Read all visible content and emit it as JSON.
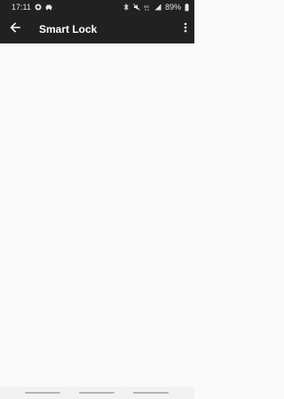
{
  "status_bar": {
    "time": "17:11",
    "battery": "89%",
    "left_icons": [
      "whatsapp-icon",
      "car-icon"
    ],
    "right_icons": [
      "bluetooth-icon",
      "mute-icon",
      "4g-icon",
      "signal-icon",
      "battery-icon"
    ]
  },
  "app_bar": {
    "title": "Smart Lock",
    "back_icon": "arrow-left-icon",
    "menu_icon": "more-vertical-icon"
  },
  "colors": {
    "toolbar": "#212121",
    "background": "#fafafa",
    "nav_bar": "#f2f2f2"
  }
}
